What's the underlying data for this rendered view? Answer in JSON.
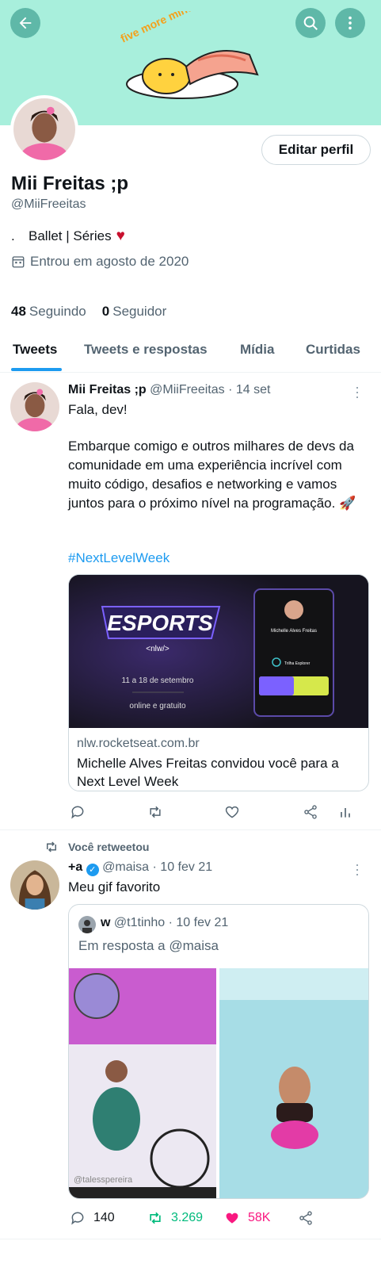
{
  "banner": {
    "art_text": "five more minutes"
  },
  "header": {
    "back_icon": "arrow-left-icon",
    "search_icon": "search-icon",
    "more_icon": "more-vertical-icon"
  },
  "profile": {
    "name": "Mii Freitas ;p",
    "handle": "@MiiFreeitas",
    "bio_prefix": ".",
    "bio": "Ballet | Séries",
    "bio_emoji": "♥",
    "joined": "Entrou em agosto de 2020",
    "following_count": "48",
    "following_label": "Seguindo",
    "followers_count": "0",
    "followers_label": "Seguidor",
    "edit_label": "Editar perfil"
  },
  "tabs": [
    {
      "label": "Tweets"
    },
    {
      "label": "Tweets e respostas"
    },
    {
      "label": "Mídia"
    },
    {
      "label": "Curtidas"
    }
  ],
  "tweets": [
    {
      "name": "Mii Freitas ;p",
      "handle_meta": "@MiiFreeitas · 14 set",
      "text_1": "Fala, dev!",
      "text_2": "Embarque comigo e outros milhares de devs da comunidade em uma experiência incrível com muito código, desafios e networking e vamos juntos para o próximo nível na programação. 🚀",
      "hashtag": "#NextLevelWeek",
      "card": {
        "image_title": "ESPORTS",
        "image_sub": "<nlw/>",
        "image_dates": "11 a 18 de setembro",
        "image_online": "online e gratuito",
        "badge_name": "Michelle Alves Freitas",
        "badge_track": "Trilha Explorer",
        "domain": "nlw.rocketseat.com.br",
        "title": "Michelle Alves Freitas convidou você para a Next Level Week"
      },
      "replies": "",
      "retweets": "",
      "likes": ""
    },
    {
      "retweet_label": "Você retweetou",
      "name": "+a",
      "handle_meta": "@maisa · 10 fev 21",
      "text_1": "Meu gif favorito",
      "quote": {
        "name": "w",
        "handle_meta": "@t1tinho · 10 fev 21",
        "reply_to": "Em resposta a @maisa",
        "watermark": "@talesspereira"
      },
      "replies": "140",
      "retweets": "3.269",
      "likes": "58K"
    }
  ]
}
